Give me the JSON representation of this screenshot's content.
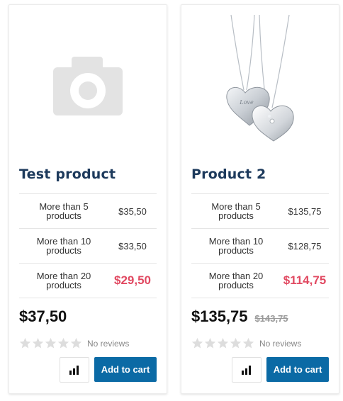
{
  "products": [
    {
      "title": "Test product",
      "image": "camera-placeholder-icon",
      "tiers": [
        {
          "label_line1": "More than 5",
          "label_line2": "products",
          "price": "$35,50"
        },
        {
          "label_line1": "More than 10",
          "label_line2": "products",
          "price": "$33,50"
        },
        {
          "label_line1": "More than 20",
          "label_line2": "products",
          "price": "$29,50"
        }
      ],
      "price": "$37,50",
      "old_price": "",
      "rating": 0,
      "reviews_text": "No reviews",
      "compare_icon": "bar-chart-icon",
      "add_to_cart_label": "Add to cart"
    },
    {
      "title": "Product 2",
      "image": "heart-pendant-necklace",
      "tiers": [
        {
          "label_line1": "More than 5",
          "label_line2": "products",
          "price": "$135,75"
        },
        {
          "label_line1": "More than 10",
          "label_line2": "products",
          "price": "$128,75"
        },
        {
          "label_line1": "More than 20",
          "label_line2": "products",
          "price": "$114,75"
        }
      ],
      "price": "$135,75",
      "old_price": "$143,75",
      "rating": 0,
      "reviews_text": "No reviews",
      "compare_icon": "bar-chart-icon",
      "add_to_cart_label": "Add to cart"
    }
  ],
  "colors": {
    "title": "#1d3a5c",
    "highlight_price": "#e14a62",
    "button": "#0b6aa5",
    "star_empty": "#dddddd"
  }
}
